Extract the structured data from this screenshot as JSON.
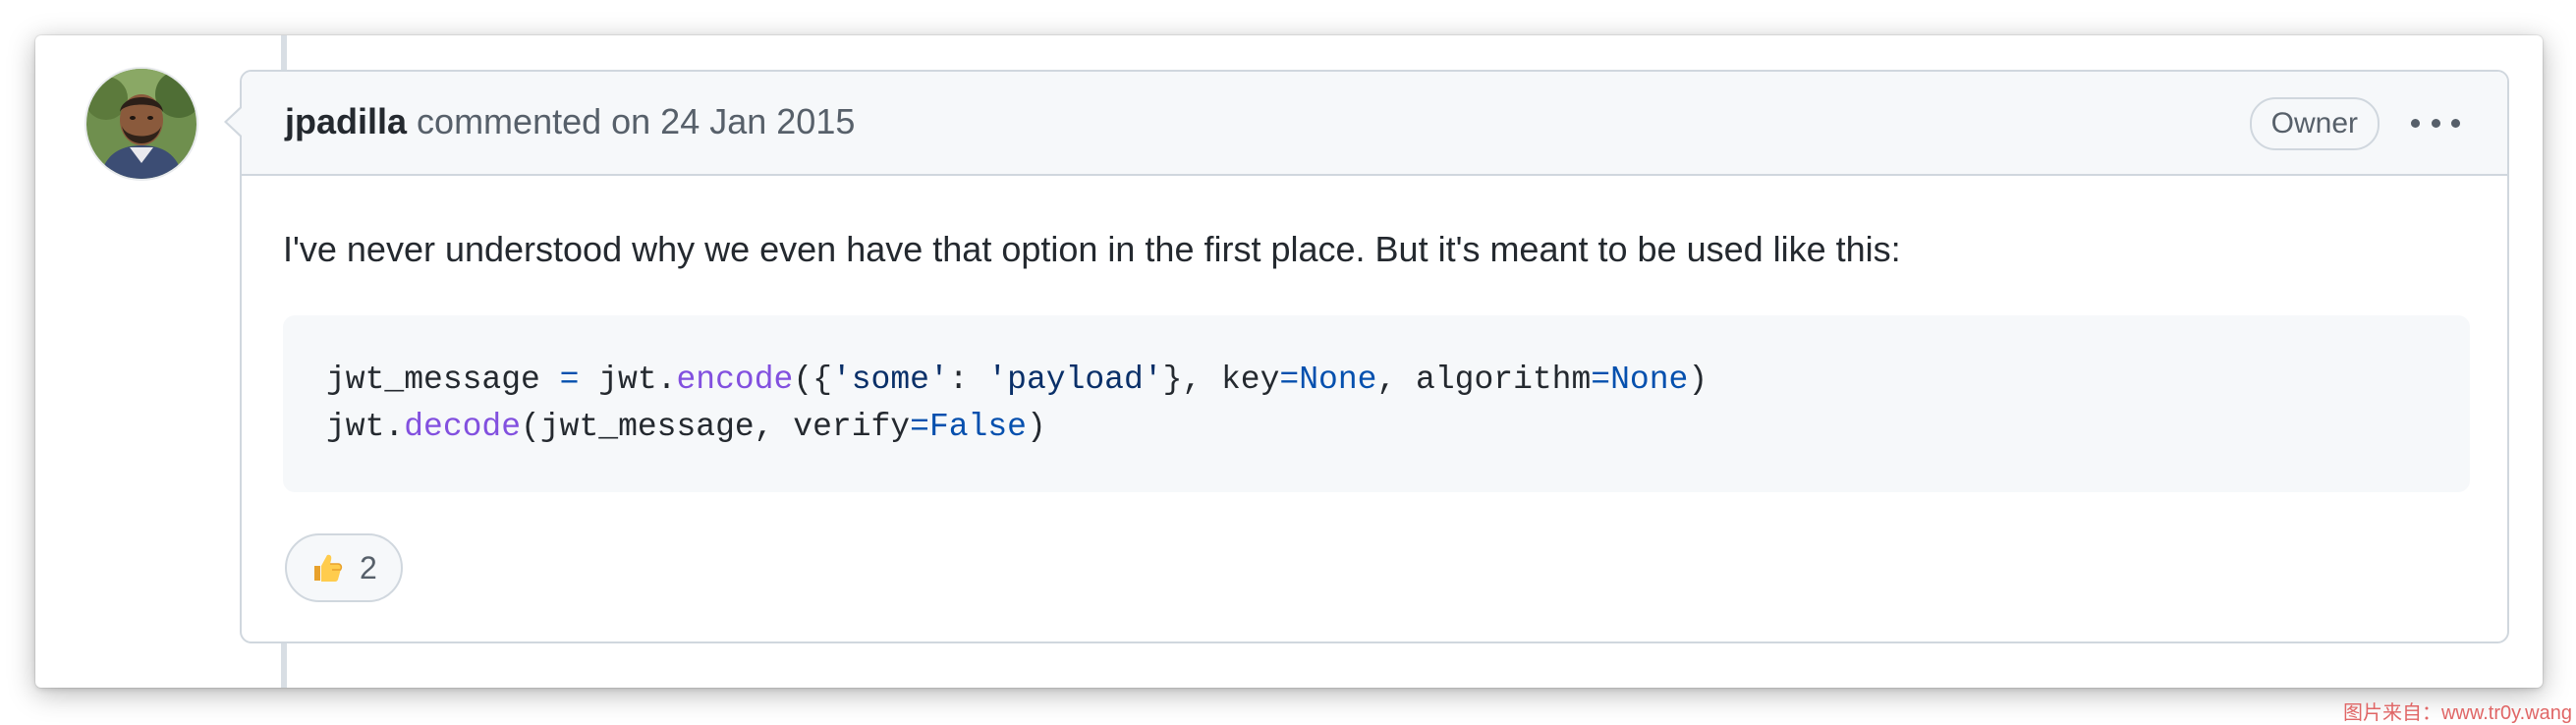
{
  "comment": {
    "author": "jpadilla",
    "meta": "commented on 24 Jan 2015",
    "badge": "Owner",
    "body": "I've never understood why we even have that option in the first place. But it's meant to be used like this:",
    "code": {
      "line1": {
        "a": "jwt_message ",
        "op1": "=",
        "b": " jwt.",
        "fn": "encode",
        "c": "({",
        "s1": "'some'",
        "d": ": ",
        "s2": "'payload'",
        "e": "}, key",
        "op2": "=",
        "kw1": "None",
        "f": ", algorithm",
        "op3": "=",
        "kw2": "None",
        "g": ")"
      },
      "line2": {
        "a": "jwt.",
        "fn": "decode",
        "b": "(jwt_message, verify",
        "op": "=",
        "kw": "False",
        "c": ")"
      }
    },
    "reaction": {
      "icon": "thumbs-up-icon",
      "count": "2"
    }
  },
  "icons": {
    "menu": "kebab-horizontal-icon",
    "avatar": "avatar"
  },
  "watermark": "图片来自：www.tr0y.wang",
  "colors": {
    "border": "#d0d7de",
    "header_bg": "#f6f8fa",
    "text": "#24292f",
    "muted": "#57606a",
    "code_function": "#8250df",
    "code_keyword": "#0550ae",
    "code_string": "#0a3069",
    "watermark": "#e06666"
  }
}
